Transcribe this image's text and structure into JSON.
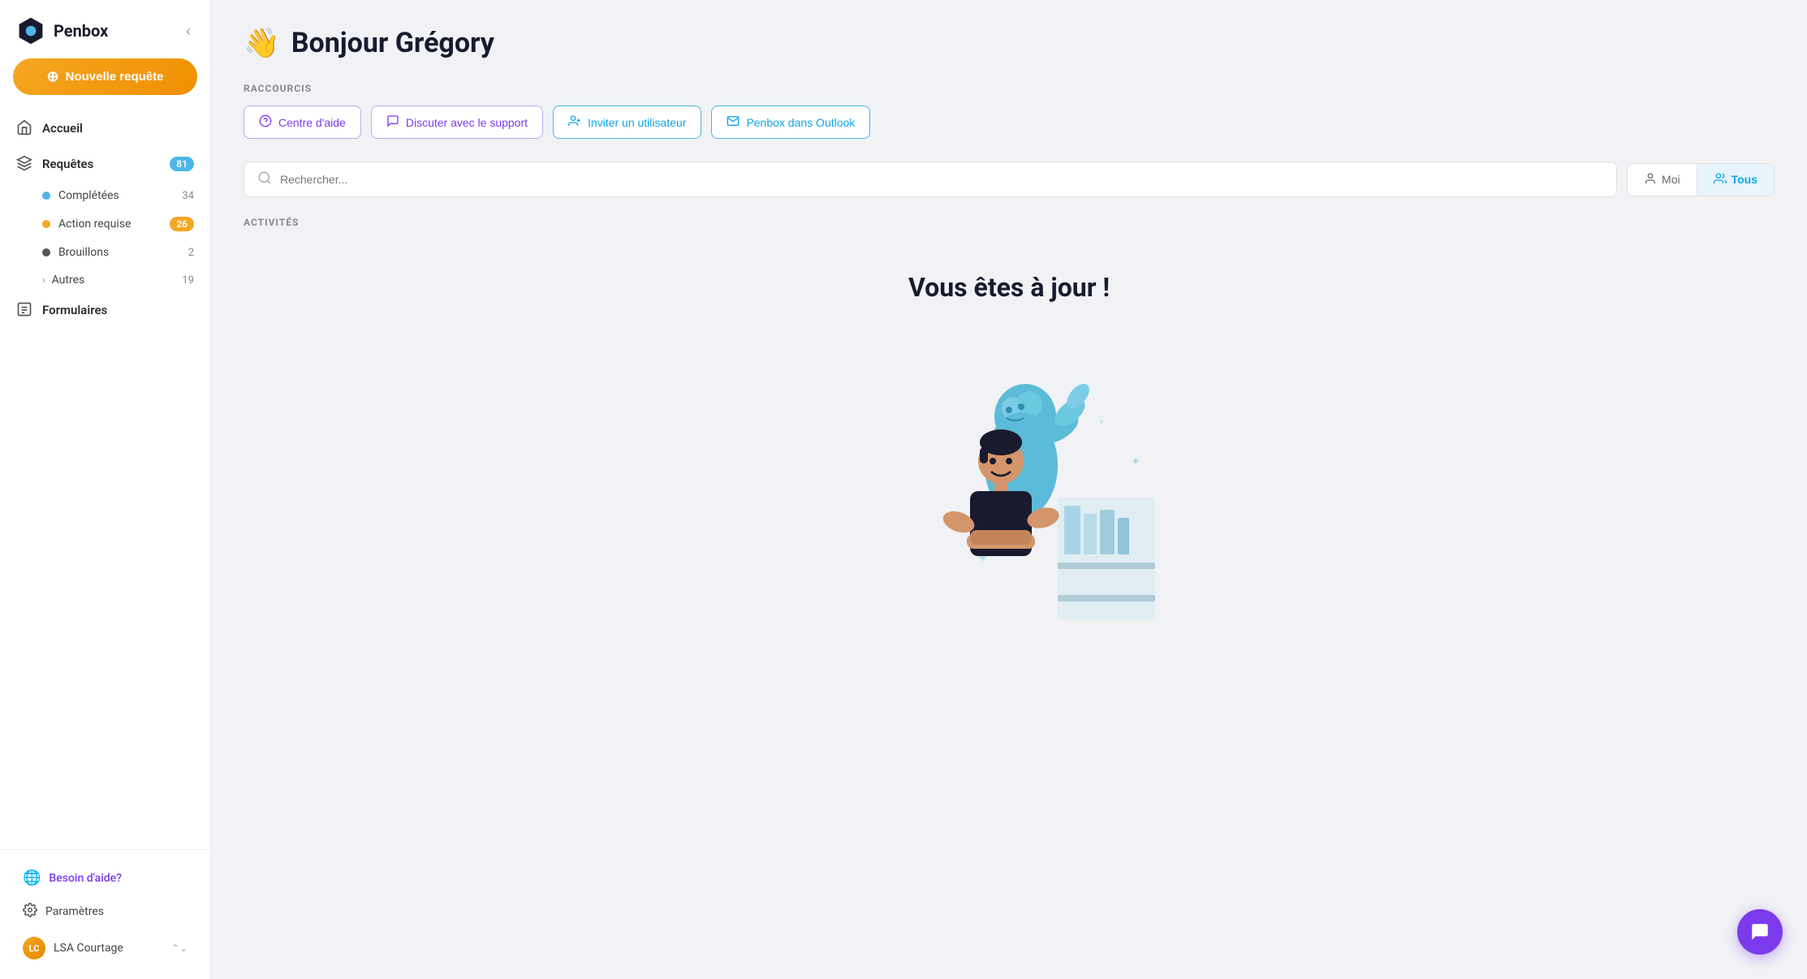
{
  "sidebar": {
    "logo": {
      "text": "Penbox",
      "collapse_label": "Collapse"
    },
    "new_request_button": "Nouvelle requête",
    "nav": {
      "accueil": "Accueil",
      "requetes": "Requêtes",
      "requetes_badge": "81",
      "completees": "Complétées",
      "completees_count": "34",
      "action_requise": "Action requise",
      "action_requise_count": "26",
      "brouillons": "Brouillons",
      "brouillons_count": "2",
      "autres": "Autres",
      "autres_count": "19",
      "formulaires": "Formulaires"
    },
    "footer": {
      "help": "Besoin d'aide?",
      "settings": "Paramètres",
      "user": "LSA Courtage"
    }
  },
  "main": {
    "greeting_emoji": "👋",
    "greeting": "Bonjour Grégory",
    "shortcuts_label": "RACCOURCIS",
    "shortcuts": [
      {
        "icon": "❓",
        "label": "Centre d'aide",
        "style": "purple"
      },
      {
        "icon": "💬",
        "label": "Discuter avec le support",
        "style": "purple"
      },
      {
        "icon": "👥",
        "label": "Inviter un utilisateur",
        "style": "teal"
      },
      {
        "icon": "📧",
        "label": "Penbox dans Outlook",
        "style": "teal"
      }
    ],
    "search_placeholder": "Rechercher...",
    "filter_moi": "Moi",
    "filter_tous": "Tous",
    "activities_label": "ACTIVITÉS",
    "up_to_date_text": "Vous êtes à jour !",
    "chat_icon": "💬"
  },
  "colors": {
    "purple": "#7c3aed",
    "teal": "#0ea5e9",
    "orange": "#f5a623",
    "blue_dot": "#4db6e8",
    "dark_dot": "#555555"
  }
}
